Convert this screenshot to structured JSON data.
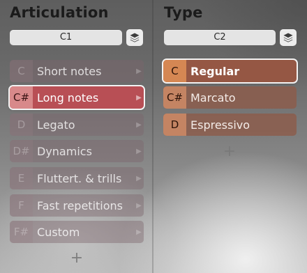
{
  "articulation": {
    "title": "Articulation",
    "selector_value": "C1",
    "layers_icon": "layers-icon",
    "add_icon": "plus-icon",
    "items": [
      {
        "key": "C",
        "label": "Short notes",
        "state": "inactive"
      },
      {
        "key": "C#",
        "label": "Long notes",
        "state": "selected"
      },
      {
        "key": "D",
        "label": "Legato",
        "state": "inactive"
      },
      {
        "key": "D#",
        "label": "Dynamics",
        "state": "inactive"
      },
      {
        "key": "E",
        "label": "Fluttert. & trills",
        "state": "inactive"
      },
      {
        "key": "F",
        "label": "Fast repetitions",
        "state": "inactive"
      },
      {
        "key": "F#",
        "label": "Custom",
        "state": "inactive"
      }
    ],
    "add_label": "+"
  },
  "type": {
    "title": "Type",
    "selector_value": "C2",
    "layers_icon": "layers-icon",
    "add_icon": "plus-icon",
    "items": [
      {
        "key": "C",
        "label": "Regular",
        "state": "selected"
      },
      {
        "key": "C#",
        "label": "Marcato",
        "state": "active"
      },
      {
        "key": "D",
        "label": "Espressivo",
        "state": "active"
      }
    ],
    "add_label": "+"
  },
  "colors": {
    "selected_articulation": "#b84f55",
    "type_row": "#8c5c4a",
    "selected_type_key": "#d58753"
  }
}
